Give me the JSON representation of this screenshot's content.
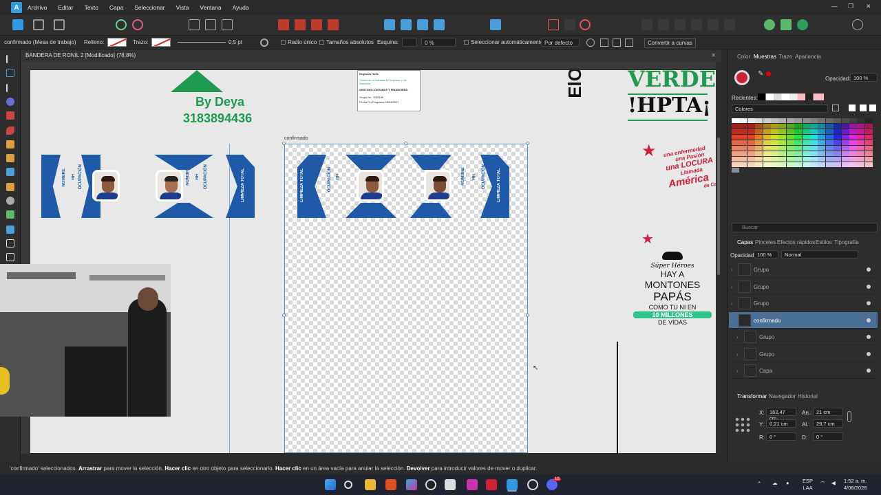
{
  "menu": [
    "Archivo",
    "Editar",
    "Texto",
    "Capa",
    "Seleccionar",
    "Vista",
    "Ventana",
    "Ayuda"
  ],
  "context_bar": {
    "selection": "confirmado (Mesa de trabajo)",
    "fill_label": "Relleno:",
    "stroke_label": "Trazo:",
    "stroke_width": "0,5 pt",
    "radio_unico": "Radio único",
    "tamanos": "Tamaños absolutos",
    "esquina_label": "Esquina:",
    "esquina_value": "0 %",
    "auto_select": "Seleccionar automáticamente:",
    "auto_select_value": "Por defecto",
    "convert": "Convertir a curvas"
  },
  "document": {
    "tab_title": "BANDERA DE RONIL 2 [Modificado] (78,8%)"
  },
  "canvas": {
    "by_deya": "By Deya",
    "phone": "3183894436",
    "artboard_label": "confirmado",
    "verde": "VERDE",
    "hpta": "!HPTA¡",
    "elo": "ElO",
    "card_texts": {
      "limpieza": "LIMPIEZA TOTAL",
      "nombre": "NOMBRE",
      "rh": "RH",
      "ocupacion": "OCUPACIÓN"
    },
    "certificate": {
      "line1": "Regional Huila",
      "line2": "Centro de la Industria la Empresa y los Servicios",
      "line3": "GESTION CONTABLE Y FINANCIERA",
      "line4": "Grupo No.",
      "line4_val": "2168180",
      "line5": "Fecha Fin Programa",
      "line5_val": "18/04/2027"
    },
    "america": {
      "l1": "una enfermedad",
      "l2": "una Pasión",
      "l3": "una LOCURA",
      "l4": "Llamada",
      "l5": "América",
      "l6": "de Cali"
    },
    "papas": {
      "l1": "Súper Héroes",
      "l2": "HAY A",
      "l3": "MONTONES",
      "l4": "PAPÁS",
      "l5": "COMO TU NI EN",
      "l6": "10 MILLONES",
      "l7": "DE VIDAS"
    }
  },
  "right_panel": {
    "top_tabs": [
      "Color",
      "Muestras",
      "Trazo",
      "Apariencia"
    ],
    "opacity_label": "Opacidad:",
    "opacity_value": "100 %",
    "recientes": "Recientes:",
    "colores": "Colores",
    "search_placeholder": "Buscar",
    "layer_tabs": [
      "Capas",
      "Pinceles",
      "Efectos rápidos",
      "Estilos",
      "Tipografía"
    ],
    "layer_opacity_label": "Opacidad:",
    "layer_opacity": "100 %",
    "blend": "Normal",
    "layers": [
      {
        "name": "Grupo",
        "indent": 0
      },
      {
        "name": "Grupo",
        "indent": 0
      },
      {
        "name": "Grupo",
        "indent": 0
      },
      {
        "name": "confirmado",
        "indent": 0,
        "selected": true
      },
      {
        "name": "Grupo",
        "indent": 1
      },
      {
        "name": "Grupo",
        "indent": 1
      },
      {
        "name": "Capa",
        "indent": 1
      }
    ],
    "transform_tabs": [
      "Transformar",
      "Navegador",
      "Historial"
    ],
    "transform": {
      "x_label": "X:",
      "x": "162,47 cm",
      "y_label": "Y:",
      "y": "0,21 cm",
      "w_label": "An.:",
      "w": "21 cm",
      "h_label": "Al.:",
      "h": "29,7 cm",
      "r_label": "R:",
      "r": "0 °",
      "s_label": "D:",
      "s": "0 °"
    }
  },
  "status": {
    "q1": "'confirmado' seleccionados. ",
    "b1": "Arrastrar",
    "t1": " para mover la selección. ",
    "b2": "Hacer clic",
    "t2": " en otro objeto para seleccionarlo. ",
    "b3": "Hacer clic",
    "t3": " en un área vacía para anular la selección. ",
    "b4": "Devolver",
    "t4": " para introducir valores de mover o duplicar."
  },
  "taskbar": {
    "lang1": "ESP",
    "lang2": "LAA",
    "time": "1:52 a. m.",
    "date": "4/08/2026",
    "badge": "10"
  },
  "colors": {
    "accent": "#1e5aa8",
    "verde": "#1f9a4f",
    "rojo": "#d01f3c",
    "sel": "#4a6f96"
  }
}
